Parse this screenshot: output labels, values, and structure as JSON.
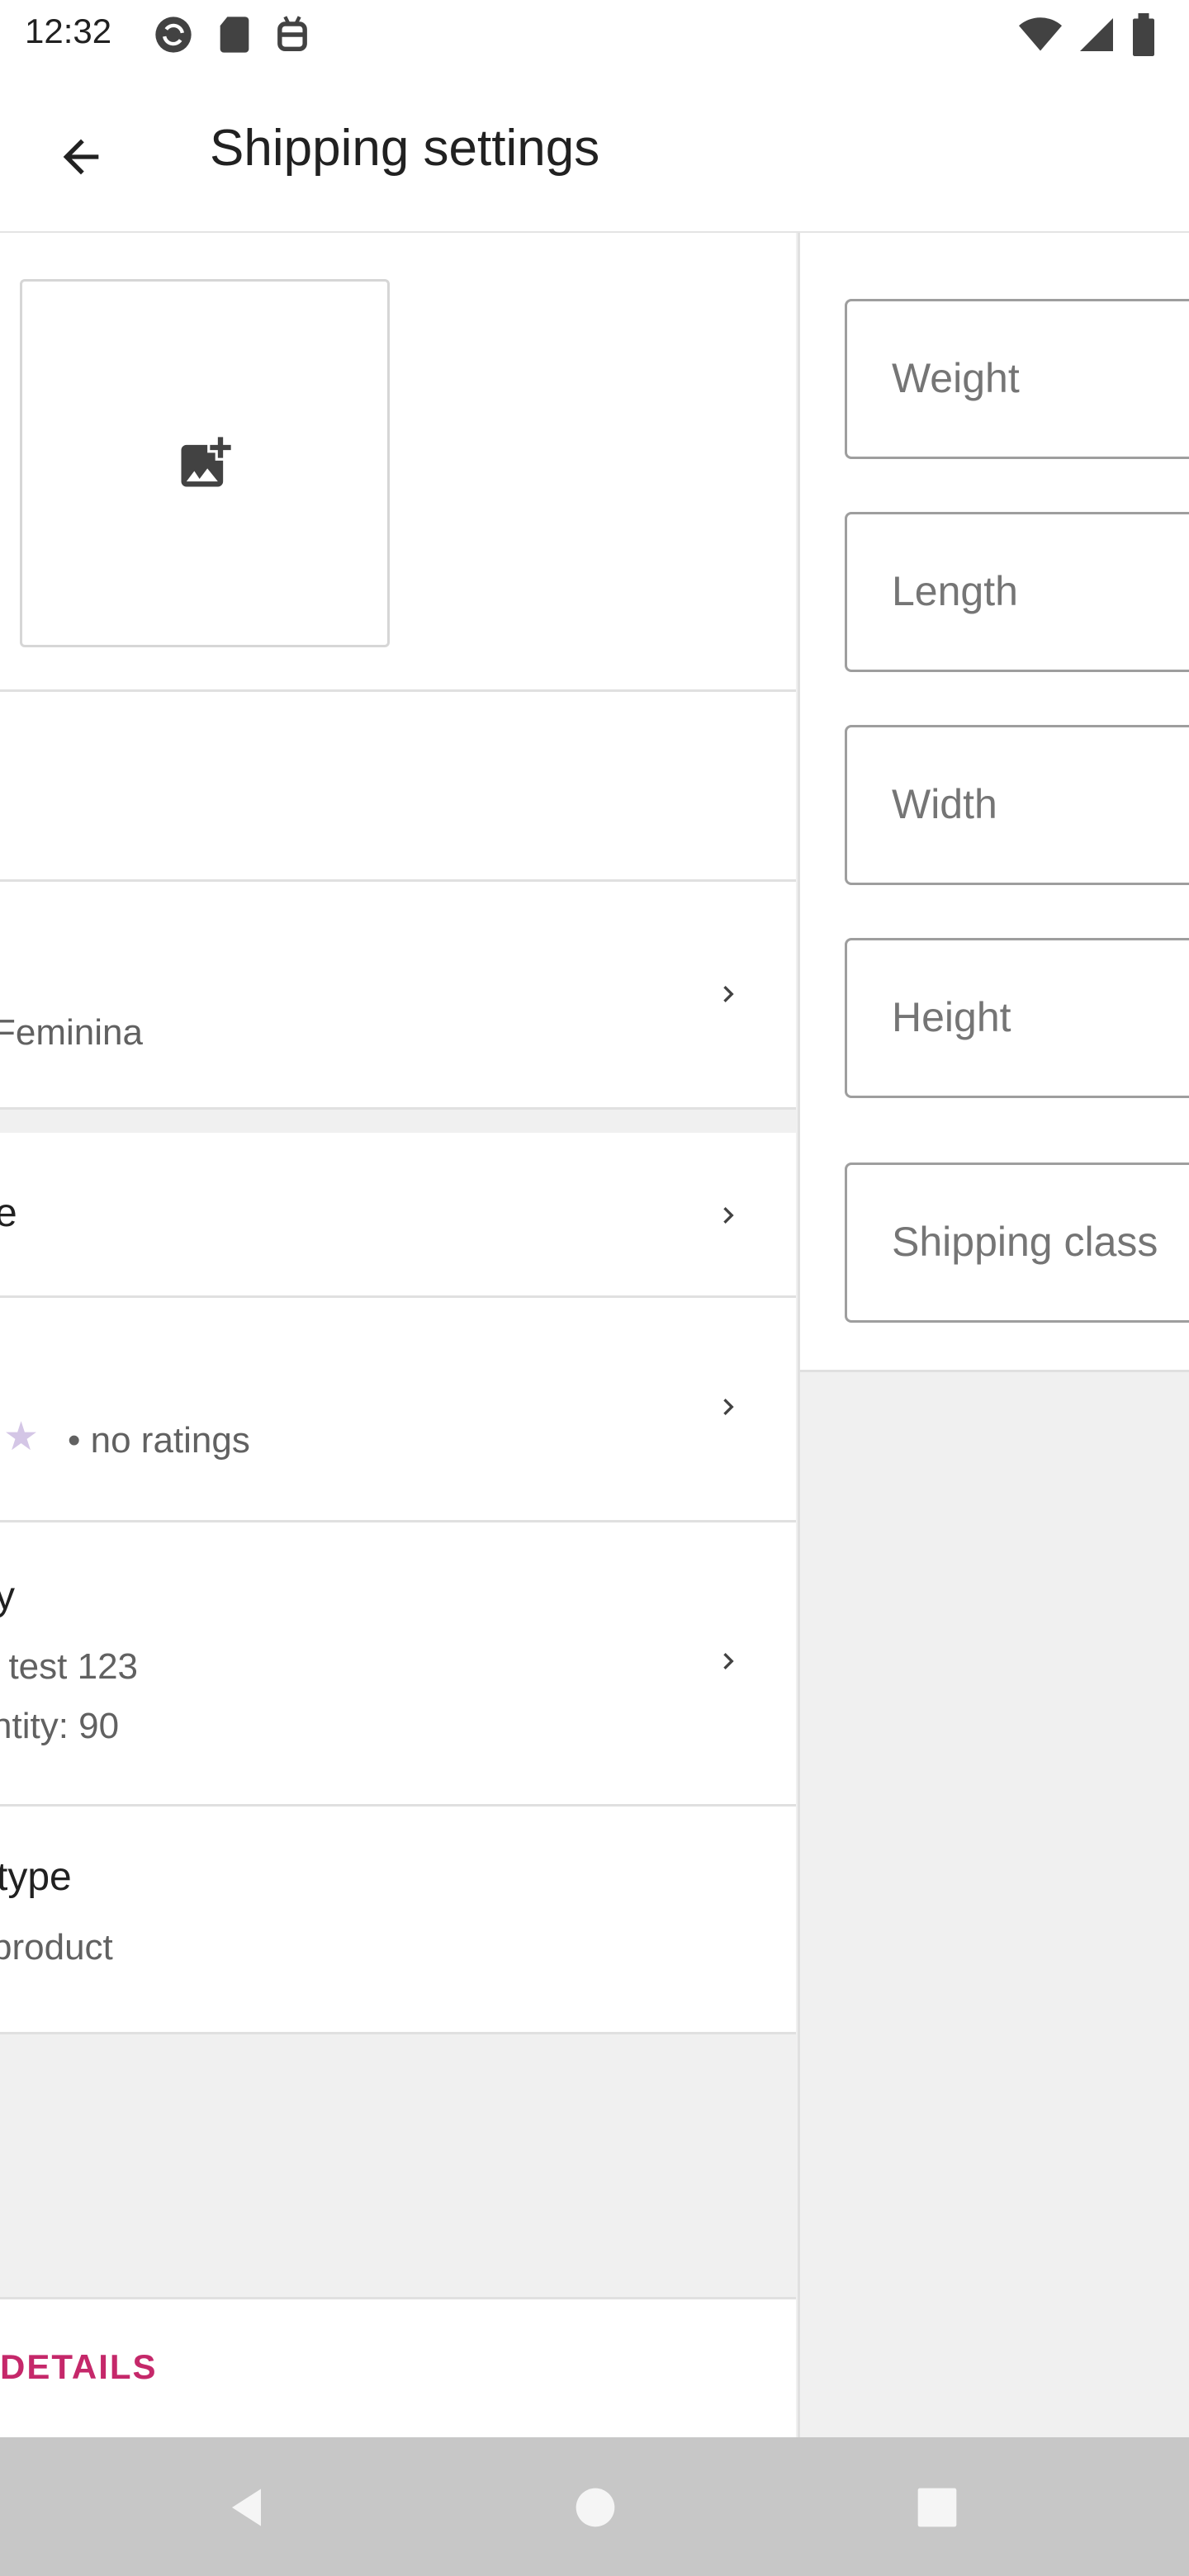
{
  "status_bar": {
    "time": "12:32",
    "left_icons": [
      "sync-icon",
      "sd-card-icon",
      "android-icon"
    ],
    "right_icons": [
      "wifi-icon",
      "signal-icon",
      "battery-icon"
    ]
  },
  "app_bar": {
    "title": "Shipping settings",
    "back_icon": "arrow-back-icon"
  },
  "product": {
    "image_icon": "add-photo-icon",
    "category_value": "Feminina",
    "price_partial": "e",
    "reviews_text": "• no ratings",
    "inventory_title_partial": "y",
    "inventory_sku_partial": ": test 123",
    "inventory_qty_partial": "ntity: 90",
    "type_title_partial": "type",
    "type_value_partial": "product",
    "details_link_partial": "DETAILS"
  },
  "shipping": {
    "weight_label": "Weight",
    "length_label": "Length",
    "width_label": "Width",
    "height_label": "Height",
    "shipping_class_label": "Shipping class"
  },
  "colors": {
    "accent": "#c5286a",
    "star": "#d4c6e6"
  }
}
